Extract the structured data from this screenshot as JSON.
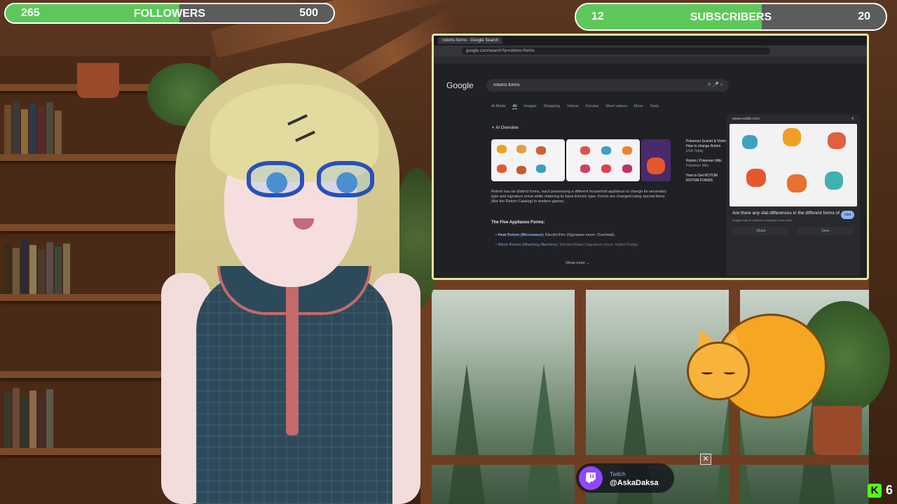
{
  "goals": {
    "followers": {
      "current": "265",
      "label": "FOLLOWERS",
      "target": "500",
      "progress": 0.53
    },
    "subscribers": {
      "current": "12",
      "label": "SUBSCRIBERS",
      "target": "20",
      "progress": 0.6
    }
  },
  "browser": {
    "tab_title": "rotoms forms - Google Search",
    "url": "google.com/search?q=rotoms+forms",
    "search_query": "rotoms forms",
    "logo": "Google",
    "tabs": [
      "AI Mode",
      "All",
      "Images",
      "Shopping",
      "Videos",
      "Forums",
      "Short videos",
      "More",
      "Tools"
    ],
    "active_tab": "All",
    "ai_overview_label": "AI Overview",
    "ai_body": "Rotom has six distinct forms, each possessing a different household appliance to change its secondary type and signature move while retaining its base Electric type. Forms are changed using special items (like the Rotom Catalog) in modern games.",
    "ai_subheading": "The Five Appliance Forms:",
    "ai_items": [
      {
        "name": "Heat Rotom (Microwave):",
        "desc": "Electric/Fire (Signature move: Overheat)."
      },
      {
        "name": "Wash Rotom (Washing Machine):",
        "desc": "Electric/Water (Signature move: Hydro Pump)."
      }
    ],
    "show_more": "Show more",
    "side_results": [
      {
        "title": "Pokemon Scarlet & Violet: How to change Rotom",
        "source": "USA Today"
      },
      {
        "title": "Rotom | Pokemon Wiki",
        "source": "Pokemon Wiki"
      },
      {
        "title": "How to Get ROTOM ROTOM FORMS",
        "source": ""
      }
    ],
    "preview": {
      "source": "www.reddit.com",
      "caption": "Are there any stat differences in the different forms of ...",
      "visit": "Visit",
      "note": "Images may be subject to copyright. Learn More",
      "share": "Share",
      "save": "Save"
    }
  },
  "twitch": {
    "platform": "Twitch",
    "handle": "@AskaDaksa"
  },
  "kick": {
    "count": "6"
  },
  "colors": {
    "goal_fill": "#5cc85a",
    "twitch": "#9146ff",
    "kick": "#53fc18",
    "capture_border": "#e8e4a0"
  }
}
